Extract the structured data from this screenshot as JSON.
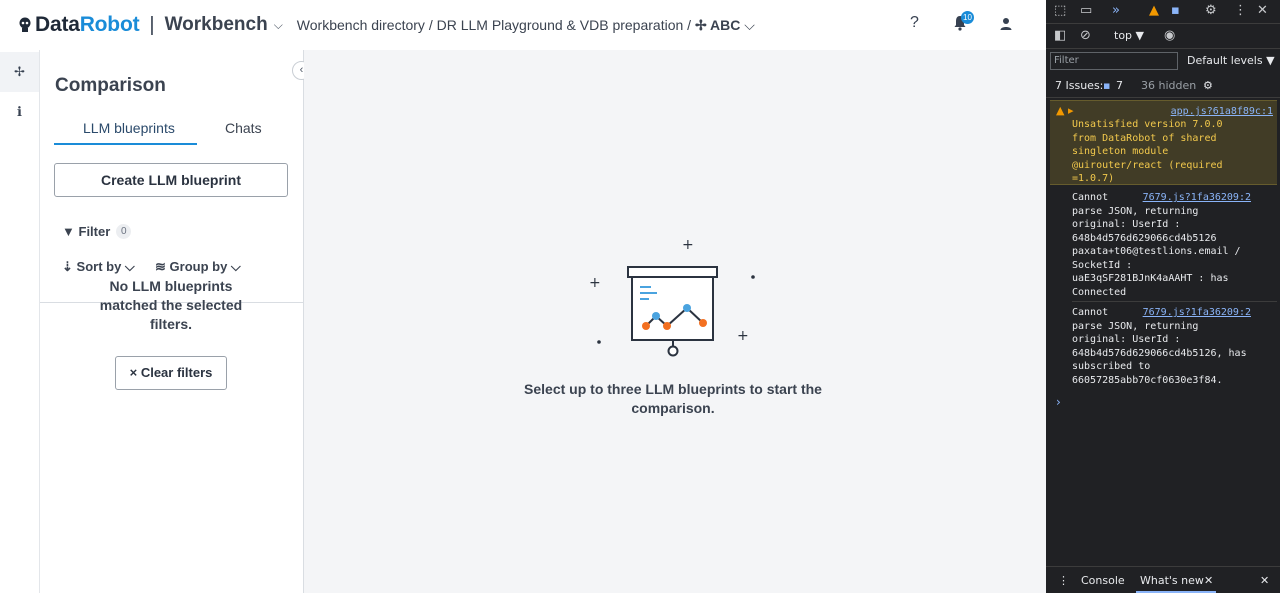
{
  "header": {
    "logo_data": "Data",
    "logo_robot": "Robot",
    "separator": "|",
    "workbench": "Workbench",
    "workbench_chevron": "⌵",
    "breadcrumb_prefix": "Workbench directory / DR LLM Playground & VDB preparation / ",
    "breadcrumb_current": "✢ ABC",
    "breadcrumb_chevron": "⌵",
    "help": "?",
    "notifications_count": "10"
  },
  "rail": {
    "item1": "✢",
    "item2": "ℹ"
  },
  "panel": {
    "title": "Comparison",
    "collapse": "‹",
    "tabs": [
      "LLM blueprints",
      "Chats"
    ],
    "create_button": "Create LLM blueprint",
    "filter_label": "Filter",
    "filter_count": "0",
    "sort_by": "Sort by ⌵",
    "group_by": "Group by ⌵",
    "empty_message": "No LLM blueprints matched the selected filters.",
    "clear_filters": "× Clear filters"
  },
  "main": {
    "message": "Select up to three LLM blueprints to start the comparison."
  },
  "devtools": {
    "context": "top ▼",
    "filter_placeholder": "Filter",
    "levels": "Default levels ▼",
    "issues_label": "7 Issues:",
    "issues_count": "7",
    "hidden": "36 hidden",
    "warning_link": "app.js?61a8f89c:1",
    "warning_text": "Unsatisfied version 7.0.0\nfrom DataRobot of shared\nsingleton module\n@uirouter/react (required\n=1.0.7)",
    "log1_link": "7679.js?1fa36209:2",
    "log1_text": "Cannot\nparse JSON, returning\noriginal: UserId :\n648b4d576d629066cd4b5126\npaxata+t06@testlions.email /\nSocketId :\nuaE3qSF281BJnK4aAAHT : has\nConnected",
    "log2_link": "7679.js?1fa36209:2",
    "log2_text": "Cannot\nparse JSON, returning\noriginal: UserId :\n648b4d576d629066cd4b5126, has\nsubscribed to\n66057285abb70cf0630e3f84.",
    "prompt": "›",
    "bottom_console": "Console",
    "bottom_whatsnew": "What's new",
    "bottom_close_tab": "✕",
    "bottom_close": "✕"
  }
}
